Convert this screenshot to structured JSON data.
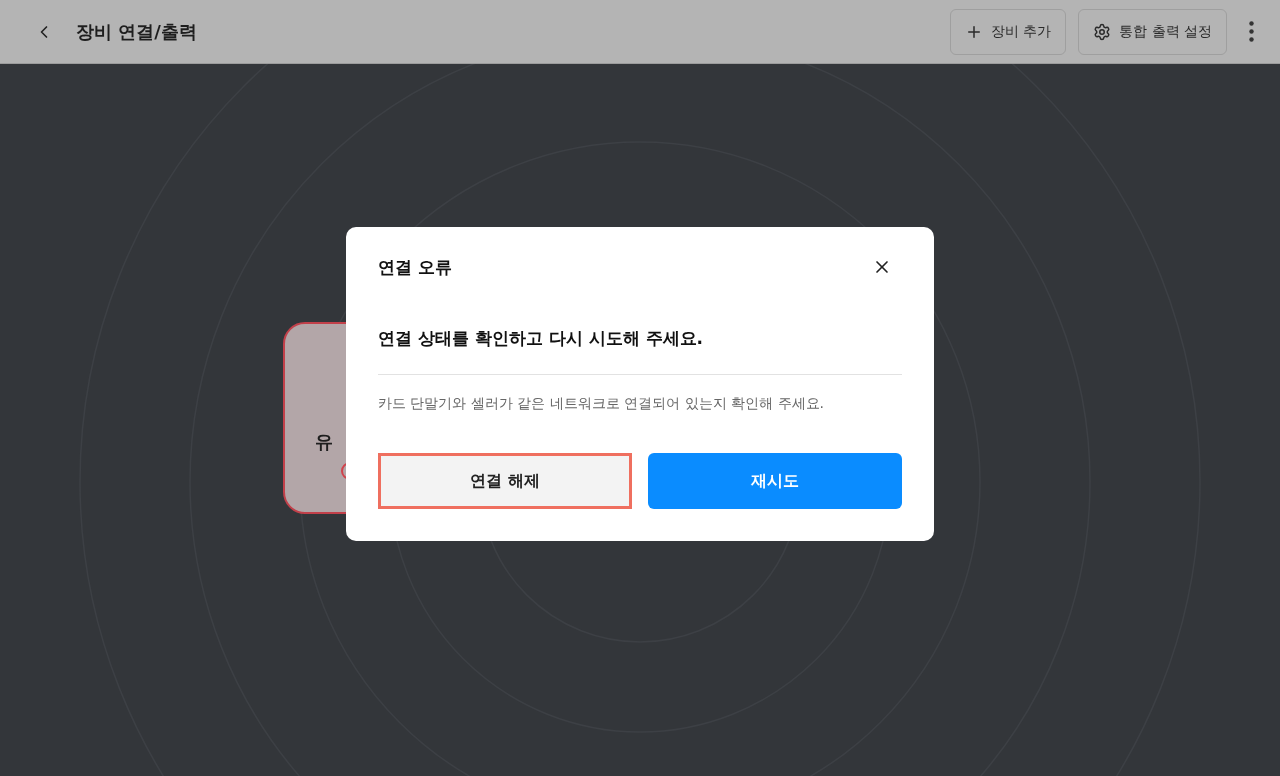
{
  "header": {
    "title": "장비 연결/출력",
    "actions": [
      {
        "label": "장비 추가",
        "kind": "add"
      },
      {
        "label": "통합 출력 설정",
        "kind": "settings"
      }
    ]
  },
  "device_card": {
    "label": "유",
    "error": true
  },
  "dialog": {
    "title": "연결 오류",
    "message": "연결 상태를 확인하고 다시 시도해 주세요.",
    "detail": "카드 단말기와 셀러가 같은 네트워크로 연결되어 있는지 확인해 주세요.",
    "buttons": [
      {
        "label": "연결 해제",
        "kind": "secondary",
        "highlighted": true
      },
      {
        "label": "재시도",
        "kind": "primary",
        "highlighted": false
      }
    ]
  }
}
